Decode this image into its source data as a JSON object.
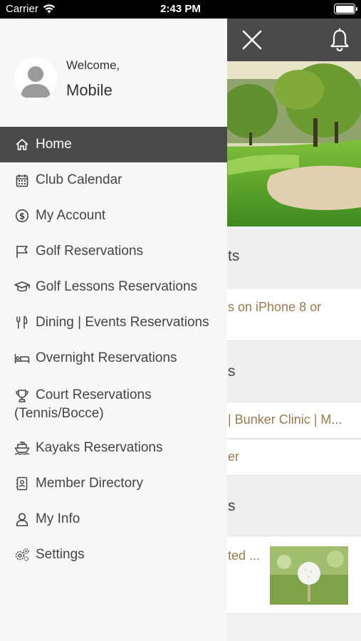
{
  "status_bar": {
    "carrier": "Carrier",
    "time": "2:43 PM",
    "battery_level": 1.0
  },
  "header": {
    "close_icon": "close-icon",
    "bell_icon": "bell-icon",
    "background_color": "#4a4a4a"
  },
  "background_content": {
    "section_1_title_fragment": "ts",
    "card_1_text_fragment": "s on iPhone 8 or",
    "section_2_title_fragment": "s",
    "card_2a_text_fragment": "| Bunker Clinic | M...",
    "card_2b_text_fragment": "er",
    "section_3_title_fragment": "s",
    "card_3_text_fragment": "ted ...",
    "link_color": "#9a7b4f"
  },
  "drawer": {
    "welcome": "Welcome,",
    "username": "Mobile",
    "items": [
      {
        "label": "Home",
        "icon": "home-icon",
        "active": true
      },
      {
        "label": "Club Calendar",
        "icon": "calendar-icon",
        "active": false
      },
      {
        "label": "My Account",
        "icon": "dollar-icon",
        "active": false
      },
      {
        "label": "Golf Reservations",
        "icon": "flag-icon",
        "active": false
      },
      {
        "label": "Golf Lessons Reservations",
        "icon": "graduation-cap-icon",
        "active": false
      },
      {
        "label": "Dining | Events Reservations",
        "icon": "utensils-icon",
        "active": false
      },
      {
        "label": "Overnight Reservations",
        "icon": "bed-icon",
        "active": false
      },
      {
        "label": "Court Reservations (Tennis/Bocce)",
        "icon": "trophy-icon",
        "active": false
      },
      {
        "label": "Kayaks Reservations",
        "icon": "boat-icon",
        "active": false
      },
      {
        "label": "Member Directory",
        "icon": "contact-book-icon",
        "active": false
      },
      {
        "label": "My Info",
        "icon": "user-icon",
        "active": false
      },
      {
        "label": "Settings",
        "icon": "gear-icon",
        "active": false
      }
    ]
  }
}
